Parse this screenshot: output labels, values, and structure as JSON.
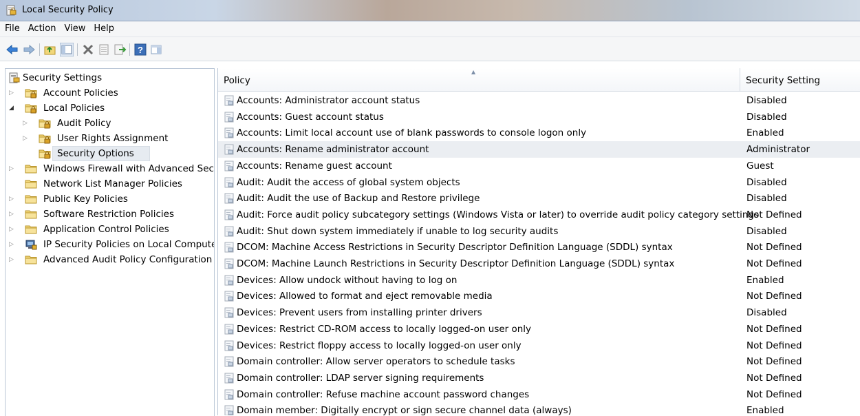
{
  "window": {
    "title": "Local Security Policy"
  },
  "menu": [
    "File",
    "Action",
    "View",
    "Help"
  ],
  "toolbar": {
    "buttons": [
      "back-arrow-icon",
      "forward-arrow-icon",
      "up-folder-icon",
      "show-hide-tree-icon",
      "delete-icon",
      "properties-icon",
      "export-list-icon",
      "help-icon",
      "show-action-pane-icon"
    ]
  },
  "tree": {
    "root": "Security Settings",
    "items": [
      {
        "label": "Account Policies",
        "level": 1,
        "expander": "collapsed",
        "icon": "locked-folder-icon"
      },
      {
        "label": "Local Policies",
        "level": 1,
        "expander": "expanded",
        "icon": "locked-folder-icon"
      },
      {
        "label": "Audit Policy",
        "level": 2,
        "expander": "collapsed",
        "icon": "locked-folder-icon"
      },
      {
        "label": "User Rights Assignment",
        "level": 2,
        "expander": "collapsed",
        "icon": "locked-folder-icon"
      },
      {
        "label": "Security Options",
        "level": 2,
        "expander": "none",
        "icon": "locked-folder-icon",
        "selected": true
      },
      {
        "label": "Windows Firewall with Advanced Secu",
        "level": 1,
        "expander": "collapsed",
        "icon": "folder-icon"
      },
      {
        "label": "Network List Manager Policies",
        "level": 1,
        "expander": "none",
        "icon": "folder-icon"
      },
      {
        "label": "Public Key Policies",
        "level": 1,
        "expander": "collapsed",
        "icon": "folder-icon"
      },
      {
        "label": "Software Restriction Policies",
        "level": 1,
        "expander": "collapsed",
        "icon": "folder-icon"
      },
      {
        "label": "Application Control Policies",
        "level": 1,
        "expander": "collapsed",
        "icon": "folder-icon"
      },
      {
        "label": "IP Security Policies on Local Compute",
        "level": 1,
        "expander": "collapsed",
        "icon": "ip-security-icon"
      },
      {
        "label": "Advanced Audit Policy Configuration",
        "level": 1,
        "expander": "collapsed",
        "icon": "folder-icon"
      }
    ]
  },
  "list": {
    "columns": {
      "policy": "Policy",
      "setting": "Security Setting"
    },
    "rows": [
      {
        "policy": "Accounts: Administrator account status",
        "setting": "Disabled"
      },
      {
        "policy": "Accounts: Guest account status",
        "setting": "Disabled"
      },
      {
        "policy": "Accounts: Limit local account use of blank passwords to console logon only",
        "setting": "Enabled"
      },
      {
        "policy": "Accounts: Rename administrator account",
        "setting": "Administrator",
        "highlighted": true
      },
      {
        "policy": "Accounts: Rename guest account",
        "setting": "Guest"
      },
      {
        "policy": "Audit: Audit the access of global system objects",
        "setting": "Disabled"
      },
      {
        "policy": "Audit: Audit the use of Backup and Restore privilege",
        "setting": "Disabled"
      },
      {
        "policy": "Audit: Force audit policy subcategory settings (Windows Vista or later) to override audit policy category settings",
        "setting": "Not Defined"
      },
      {
        "policy": "Audit: Shut down system immediately if unable to log security audits",
        "setting": "Disabled"
      },
      {
        "policy": "DCOM: Machine Access Restrictions in Security Descriptor Definition Language (SDDL) syntax",
        "setting": "Not Defined"
      },
      {
        "policy": "DCOM: Machine Launch Restrictions in Security Descriptor Definition Language (SDDL) syntax",
        "setting": "Not Defined"
      },
      {
        "policy": "Devices: Allow undock without having to log on",
        "setting": "Enabled"
      },
      {
        "policy": "Devices: Allowed to format and eject removable media",
        "setting": "Not Defined"
      },
      {
        "policy": "Devices: Prevent users from installing printer drivers",
        "setting": "Disabled"
      },
      {
        "policy": "Devices: Restrict CD-ROM access to locally logged-on user only",
        "setting": "Not Defined"
      },
      {
        "policy": "Devices: Restrict floppy access to locally logged-on user only",
        "setting": "Not Defined"
      },
      {
        "policy": "Domain controller: Allow server operators to schedule tasks",
        "setting": "Not Defined"
      },
      {
        "policy": "Domain controller: LDAP server signing requirements",
        "setting": "Not Defined"
      },
      {
        "policy": "Domain controller: Refuse machine account password changes",
        "setting": "Not Defined"
      },
      {
        "policy": "Domain member: Digitally encrypt or sign secure channel data (always)",
        "setting": "Enabled"
      }
    ]
  },
  "colors": {
    "folder": "#f2d77a",
    "lock": "#d9a227",
    "selection": "#e6ebf1",
    "hover": "#ebeef2"
  }
}
